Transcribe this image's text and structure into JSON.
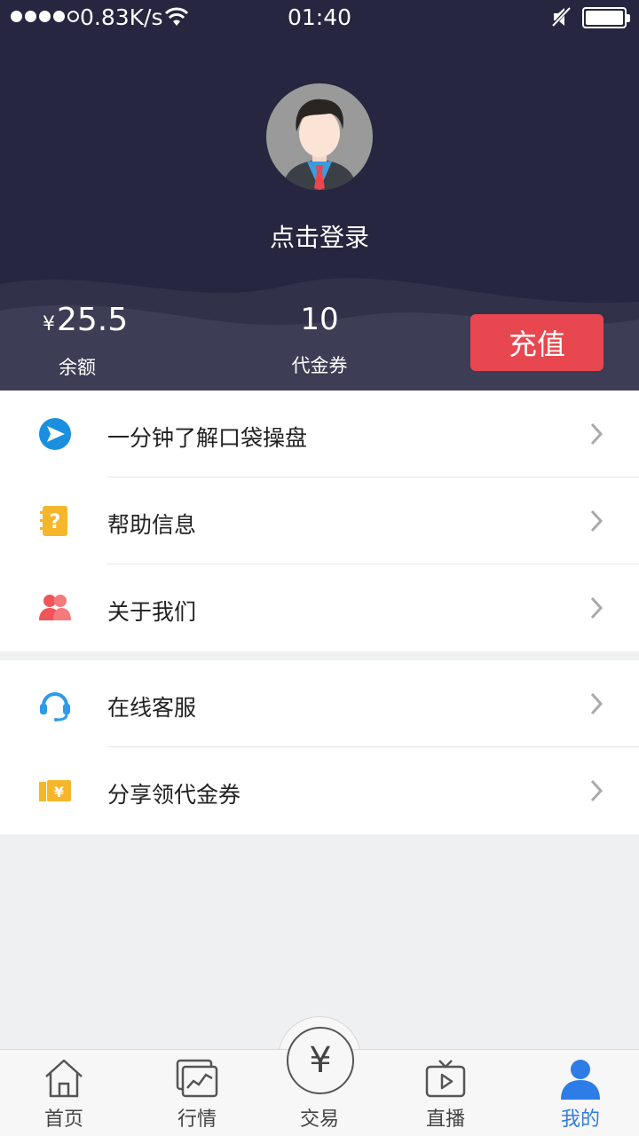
{
  "status": {
    "speed": "0.83K/s",
    "time": "01:40"
  },
  "profile": {
    "login_text": "点击登录"
  },
  "account": {
    "currency": "¥",
    "balance": "25.5",
    "balance_label": "余额",
    "coupons": "10",
    "coupons_label": "代金券",
    "recharge_label": "充值"
  },
  "menu": {
    "group1": [
      {
        "label": "一分钟了解口袋操盘",
        "icon": "play-arrow-icon",
        "color": "#1a8fe0"
      },
      {
        "label": "帮助信息",
        "icon": "help-book-icon",
        "color": "#f5b62a"
      },
      {
        "label": "关于我们",
        "icon": "users-icon",
        "color": "#f0555a"
      }
    ],
    "group2": [
      {
        "label": "在线客服",
        "icon": "headset-icon",
        "color": "#2e9ae8"
      },
      {
        "label": "分享领代金券",
        "icon": "ticket-icon",
        "color": "#f5b62a"
      }
    ]
  },
  "tabs": {
    "home": "首页",
    "market": "行情",
    "trade": "交易",
    "trade_symbol": "¥",
    "live": "直播",
    "mine": "我的"
  },
  "colors": {
    "header_bg": "#262640",
    "accent_red": "#e8474f",
    "active_tab": "#2e7ce6"
  }
}
